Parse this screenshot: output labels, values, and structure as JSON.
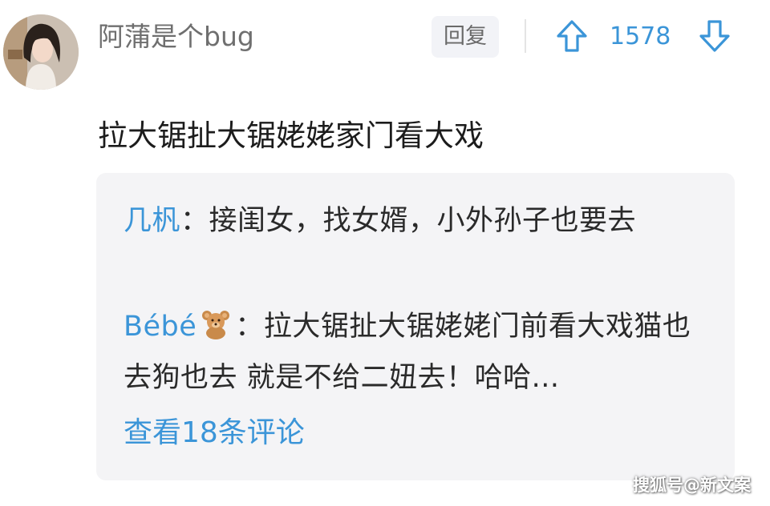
{
  "comment": {
    "username": "阿蒲是个bug",
    "reply_label": "回复",
    "vote_count": "1578",
    "text": "拉大锯扯大锯姥姥家门看大戏"
  },
  "replies": {
    "items": [
      {
        "author": "几杋",
        "separator": "：",
        "text": "接闺女，找女婿，小外孙子也要去"
      },
      {
        "author": "Bébé",
        "emoji": "teddy-bear-icon",
        "separator": "：",
        "text": "拉大锯扯大锯姥姥门前看大戏猫也去狗也去 就是不给二妞去！哈哈..."
      }
    ],
    "view_all_label": "查看18条评论"
  },
  "watermark": "搜狐号@新文案",
  "colors": {
    "accent": "#3b95d8",
    "username": "#6f6f6f",
    "reply_box_bg": "#f4f4f6",
    "text": "#1c1c1c"
  }
}
